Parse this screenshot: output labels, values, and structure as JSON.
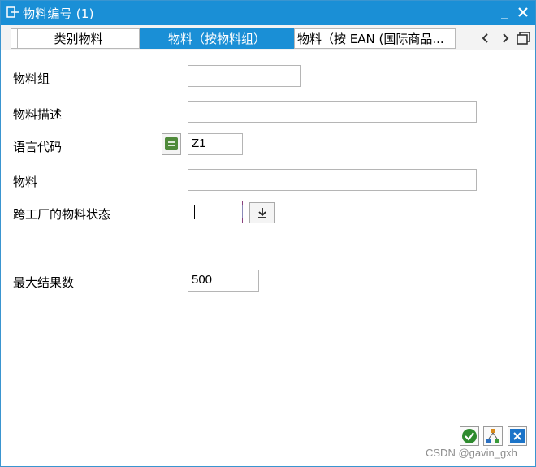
{
  "window": {
    "title": "物料编号 (1)"
  },
  "tabs": [
    {
      "label": "类别物料",
      "active": false
    },
    {
      "label": "物料（按物料组）",
      "active": true
    },
    {
      "label": "物料（按 EAN (国际商品...",
      "active": false
    }
  ],
  "form": {
    "material_group": {
      "label": "物料组",
      "value": ""
    },
    "material_description": {
      "label": "物料描述",
      "value": ""
    },
    "language_code": {
      "label": "语言代码",
      "value": "Z1"
    },
    "material": {
      "label": "物料",
      "value": ""
    },
    "cross_plant_status": {
      "label": "跨工厂的物料状态",
      "value": ""
    },
    "max_results": {
      "label": "最大结果数",
      "value": "500"
    }
  },
  "watermark": "CSDN @gavin_gxh",
  "colors": {
    "titlebar": "#1a8fd6",
    "active_tab": "#1a8fd6",
    "confirm_green": "#2e8b2e",
    "cancel_blue": "#1c74c8",
    "lang_button_green": "#4f8a3a"
  }
}
